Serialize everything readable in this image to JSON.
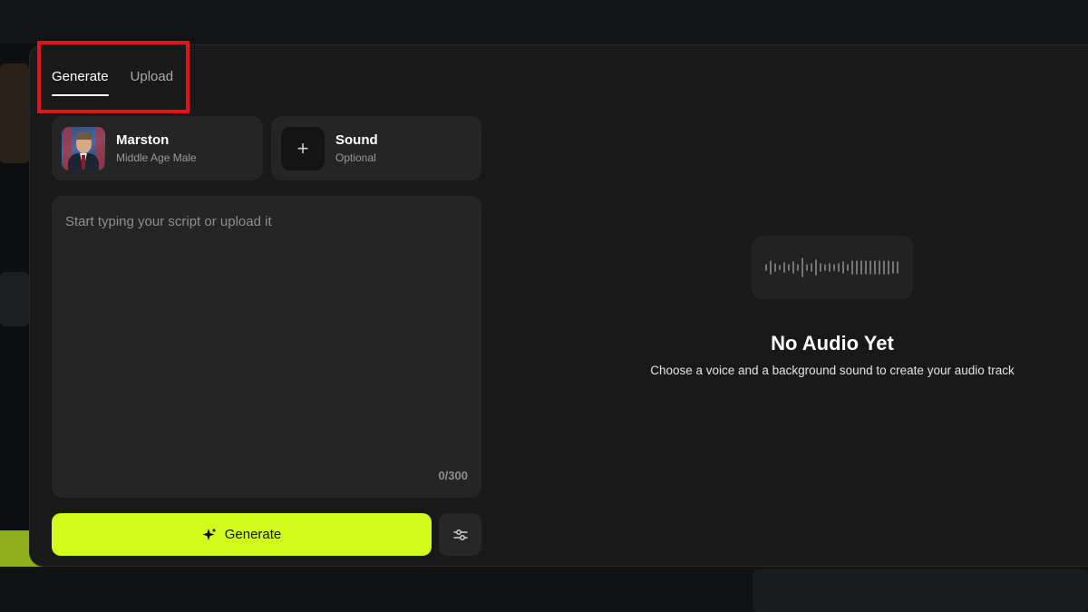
{
  "tabs": [
    {
      "label": "Generate",
      "active": true
    },
    {
      "label": "Upload",
      "active": false
    }
  ],
  "voice": {
    "name": "Marston",
    "description": "Middle Age Male"
  },
  "sound": {
    "title": "Sound",
    "subtitle": "Optional",
    "icon": "plus-icon"
  },
  "script": {
    "placeholder": "Start typing your script or upload it",
    "value": "",
    "counter": "0/300"
  },
  "actions": {
    "generate_label": "Generate",
    "generate_icon": "sparkle-icon",
    "settings_icon": "sliders-icon"
  },
  "empty_state": {
    "icon": "waveform-icon",
    "title": "No Audio Yet",
    "subtitle": "Choose a voice and a background sound to create your audio track"
  },
  "colors": {
    "accent": "#d2fb1c",
    "highlight": "#e6121a",
    "panel": "#191919",
    "card": "#252525"
  }
}
